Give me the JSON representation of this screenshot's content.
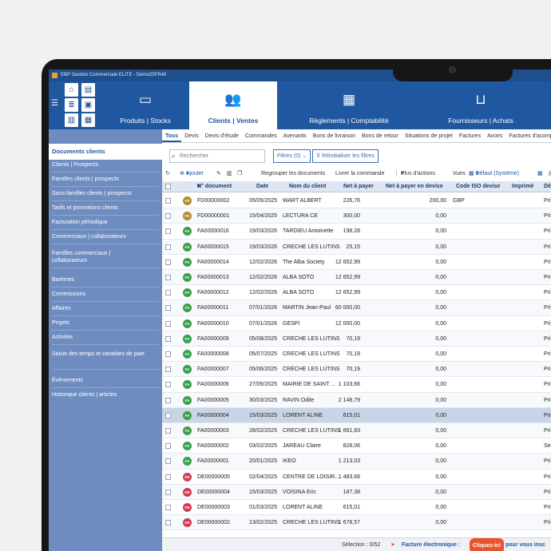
{
  "window": {
    "title": "EBP Gestion Commerciale ELITE - Demo25FR40"
  },
  "ribbon": {
    "tabs": [
      {
        "label": "Produits | Stocks",
        "icon": "box-icon"
      },
      {
        "label": "Clients | Ventes",
        "icon": "users-icon"
      },
      {
        "label": "Règlements | Comptabilité",
        "icon": "calculator-icon"
      },
      {
        "label": "Fournisseurs | Achats",
        "icon": "basket-icon"
      }
    ],
    "active_tab": "Clients | Ventes"
  },
  "sidebar": {
    "header": "Documents clients",
    "items": [
      "Clients | Prospects",
      "Familles clients | prospects",
      "Sous-familles clients | prospects",
      "Tarifs et promotions clients",
      "Facturation périodique",
      "Commerciaux | collaborateurs",
      "Familles commerciaux | collaborateurs",
      "Barèmes",
      "Commissions",
      "Affaires",
      "Projets",
      "Activités",
      "Saisie des temps et variables de paie",
      "Évènements",
      "Historique clients | articles"
    ]
  },
  "tabs": [
    "Tous",
    "Devis",
    "Devis d'étude",
    "Commandes",
    "Avenants",
    "Bons de livraison",
    "Bons de retour",
    "Situations de projet",
    "Factures",
    "Avoirs",
    "Factures d'acompte"
  ],
  "filters": {
    "search_placeholder": "Rechercher",
    "filters_label": "Filtres (0)",
    "reset_label": "Réinitialiser les filtres"
  },
  "toolbar": {
    "add": "Ajouter",
    "group": "Regrouper les documents",
    "deliver": "Livrer la commande",
    "more": "Plus d'actions",
    "views": "Vues",
    "default_view": "Défaut (Système)"
  },
  "table": {
    "columns": [
      "N° document",
      "Date",
      "Nom du client",
      "Net à payer",
      "Net à payer en devise",
      "Code ISO devise",
      "Imprimé",
      "Dé"
    ],
    "rows": [
      {
        "type": "FD",
        "doc": "FD00000002",
        "date": "05/05/2025",
        "client": "WART ALBERT",
        "net": "226,76",
        "net_dev": "200,00",
        "iso": "GBP",
        "last": "Prin"
      },
      {
        "type": "FD",
        "doc": "FD00000001",
        "date": "15/04/2025",
        "client": "LECTURA CE",
        "net": "300,00",
        "net_dev": "0,00",
        "iso": "",
        "last": "Prin"
      },
      {
        "type": "FA",
        "doc": "FA00000016",
        "date": "19/03/2026",
        "client": "TARDIEU Antoinette",
        "net": "198,28",
        "net_dev": "0,00",
        "iso": "",
        "last": "Prin"
      },
      {
        "type": "FA",
        "doc": "FA00000015",
        "date": "19/03/2026",
        "client": "CRECHE LES LUTINS",
        "net": "25,15",
        "net_dev": "0,00",
        "iso": "",
        "last": "Prin"
      },
      {
        "type": "FA",
        "doc": "FA00000014",
        "date": "12/02/2026",
        "client": "The Alba Society",
        "net": "12 652,99",
        "net_dev": "0,00",
        "iso": "",
        "last": "Prin"
      },
      {
        "type": "FA",
        "doc": "FA00000013",
        "date": "12/02/2026",
        "client": "ALBA SOTO",
        "net": "12 652,99",
        "net_dev": "0,00",
        "iso": "",
        "last": "Prin"
      },
      {
        "type": "FA",
        "doc": "FA00000012",
        "date": "12/02/2026",
        "client": "ALBA SOTO",
        "net": "12 652,99",
        "net_dev": "0,00",
        "iso": "",
        "last": "Prin"
      },
      {
        "type": "FA",
        "doc": "FA00000011",
        "date": "07/01/2026",
        "client": "MARTIN Jean-Paul",
        "net": "60 000,00",
        "net_dev": "0,00",
        "iso": "",
        "last": "Prin"
      },
      {
        "type": "FA",
        "doc": "FA00000010",
        "date": "07/01/2026",
        "client": "GESPI",
        "net": "12 000,00",
        "net_dev": "0,00",
        "iso": "",
        "last": "Prin"
      },
      {
        "type": "FA",
        "doc": "FA00000009",
        "date": "05/08/2025",
        "client": "CRECHE LES LUTINS",
        "net": "70,19",
        "net_dev": "0,00",
        "iso": "",
        "last": "Prin"
      },
      {
        "type": "FA",
        "doc": "FA00000008",
        "date": "05/07/2025",
        "client": "CRECHE LES LUTINS",
        "net": "70,19",
        "net_dev": "0,00",
        "iso": "",
        "last": "Prin"
      },
      {
        "type": "FA",
        "doc": "FA00000007",
        "date": "05/06/2025",
        "client": "CRECHE LES LUTINS",
        "net": "70,19",
        "net_dev": "0,00",
        "iso": "",
        "last": "Prin"
      },
      {
        "type": "FA",
        "doc": "FA00000006",
        "date": "27/05/2025",
        "client": "MAIRIE DE SAINT ...",
        "net": "1 103,66",
        "net_dev": "0,00",
        "iso": "",
        "last": "Prin"
      },
      {
        "type": "FA",
        "doc": "FA00000005",
        "date": "30/03/2025",
        "client": "RAVIN Odile",
        "net": "2 148,79",
        "net_dev": "0,00",
        "iso": "",
        "last": "Prin"
      },
      {
        "type": "FA",
        "doc": "FA00000004",
        "date": "15/03/2025",
        "client": "LORENT ALINE",
        "net": "615,01",
        "net_dev": "0,00",
        "iso": "",
        "last": "Prin"
      },
      {
        "type": "FA",
        "doc": "FA00000003",
        "date": "28/02/2025",
        "client": "CRECHE LES LUTINS",
        "net": "1 661,83",
        "net_dev": "0,00",
        "iso": "",
        "last": "Prin"
      },
      {
        "type": "FA",
        "doc": "FA00000002",
        "date": "03/02/2025",
        "client": "JAREAU Claire",
        "net": "828,06",
        "net_dev": "0,00",
        "iso": "",
        "last": "Sec"
      },
      {
        "type": "FA",
        "doc": "FA00000001",
        "date": "20/01/2025",
        "client": "IKEO",
        "net": "1 213,03",
        "net_dev": "0,00",
        "iso": "",
        "last": "Prin"
      },
      {
        "type": "DE",
        "doc": "DE00000005",
        "date": "02/04/2025",
        "client": "CENTRE DE LOISIR...",
        "net": "1 483,66",
        "net_dev": "0,00",
        "iso": "",
        "last": "Prin"
      },
      {
        "type": "DE",
        "doc": "DE00000004",
        "date": "15/03/2025",
        "client": "VOISINA Eric",
        "net": "187,38",
        "net_dev": "0,00",
        "iso": "",
        "last": "Prin"
      },
      {
        "type": "DE",
        "doc": "DE00000003",
        "date": "01/03/2025",
        "client": "LORENT ALINE",
        "net": "615,01",
        "net_dev": "0,00",
        "iso": "",
        "last": "Prin"
      },
      {
        "type": "DE",
        "doc": "DE00000002",
        "date": "13/02/2025",
        "client": "CRECHE LES LUTINS",
        "net": "1 678,57",
        "net_dev": "0,00",
        "iso": "",
        "last": "Prin"
      }
    ],
    "selected_doc": "FA00000004"
  },
  "status": {
    "selection": "Sélection : 0/52",
    "invoice_label": "Facture électronique :",
    "cta": "Cliquez-ici",
    "cta_suffix": "pour vous insc"
  },
  "colors": {
    "brand_blue": "#1f57a0",
    "sidebar": "#6f8cc0",
    "badge_fd": "#b08d2e",
    "badge_fa": "#3aa04a",
    "badge_de": "#d23b52",
    "accent_orange": "#e8542a"
  }
}
